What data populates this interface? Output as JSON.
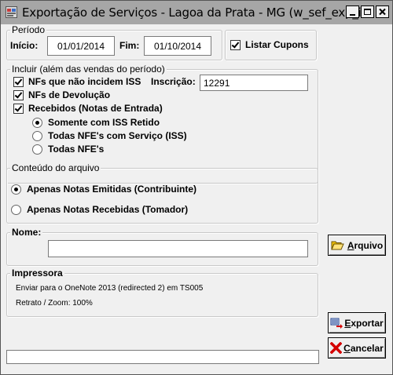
{
  "window": {
    "title": "Exportação de Serviços - Lagoa da Prata - MG (w_sef_exp_is..."
  },
  "periodo": {
    "legend": "Período",
    "inicio_label": "Início:",
    "inicio_value": "01/01/2014",
    "fim_label": "Fim:",
    "fim_value": "01/10/2014"
  },
  "listar_cupons": {
    "label": "Listar Cupons",
    "checked": true
  },
  "incluir": {
    "legend": "Incluir (além das vendas do período)",
    "nfs_nao_incidem_label": "NFs que não incidem ISS",
    "inscricao_label": "Inscrição:",
    "inscricao_value": "12291",
    "nfs_devolucao_label": "NFs de Devolução",
    "recebidos_label": "Recebidos (Notas de Entrada)",
    "radio_options": [
      "Somente com ISS Retido",
      "Todas NFE's com Serviço (ISS)",
      "Todas NFE's"
    ],
    "selected_option": "Somente com ISS Retido"
  },
  "conteudo": {
    "legend": "Conteúdo do arquivo",
    "options": [
      "Apenas Notas Emitidas (Contribuinte)",
      "Apenas Notas Recebidas (Tomador)"
    ],
    "selected_option": "Apenas Notas Emitidas (Contribuinte)"
  },
  "nome": {
    "legend": "Nome:",
    "value": ""
  },
  "impressora": {
    "legend": "Impressora",
    "line1": "Enviar para o OneNote 2013 (redirected 2) em TS005",
    "line2": "Retrato / Zoom: 100%"
  },
  "buttons": {
    "arquivo_hotkey": "A",
    "arquivo_rest": "rquivo",
    "exportar_hotkey": "E",
    "exportar_rest": "xportar",
    "cancelar_hotkey": "C",
    "cancelar_rest": "ancelar"
  },
  "colors": {
    "titlebar": "#a6a6a6",
    "window_bg": "#f0f0f0",
    "cancel_icon": "#d40000",
    "folder_icon": "#f2c200"
  }
}
